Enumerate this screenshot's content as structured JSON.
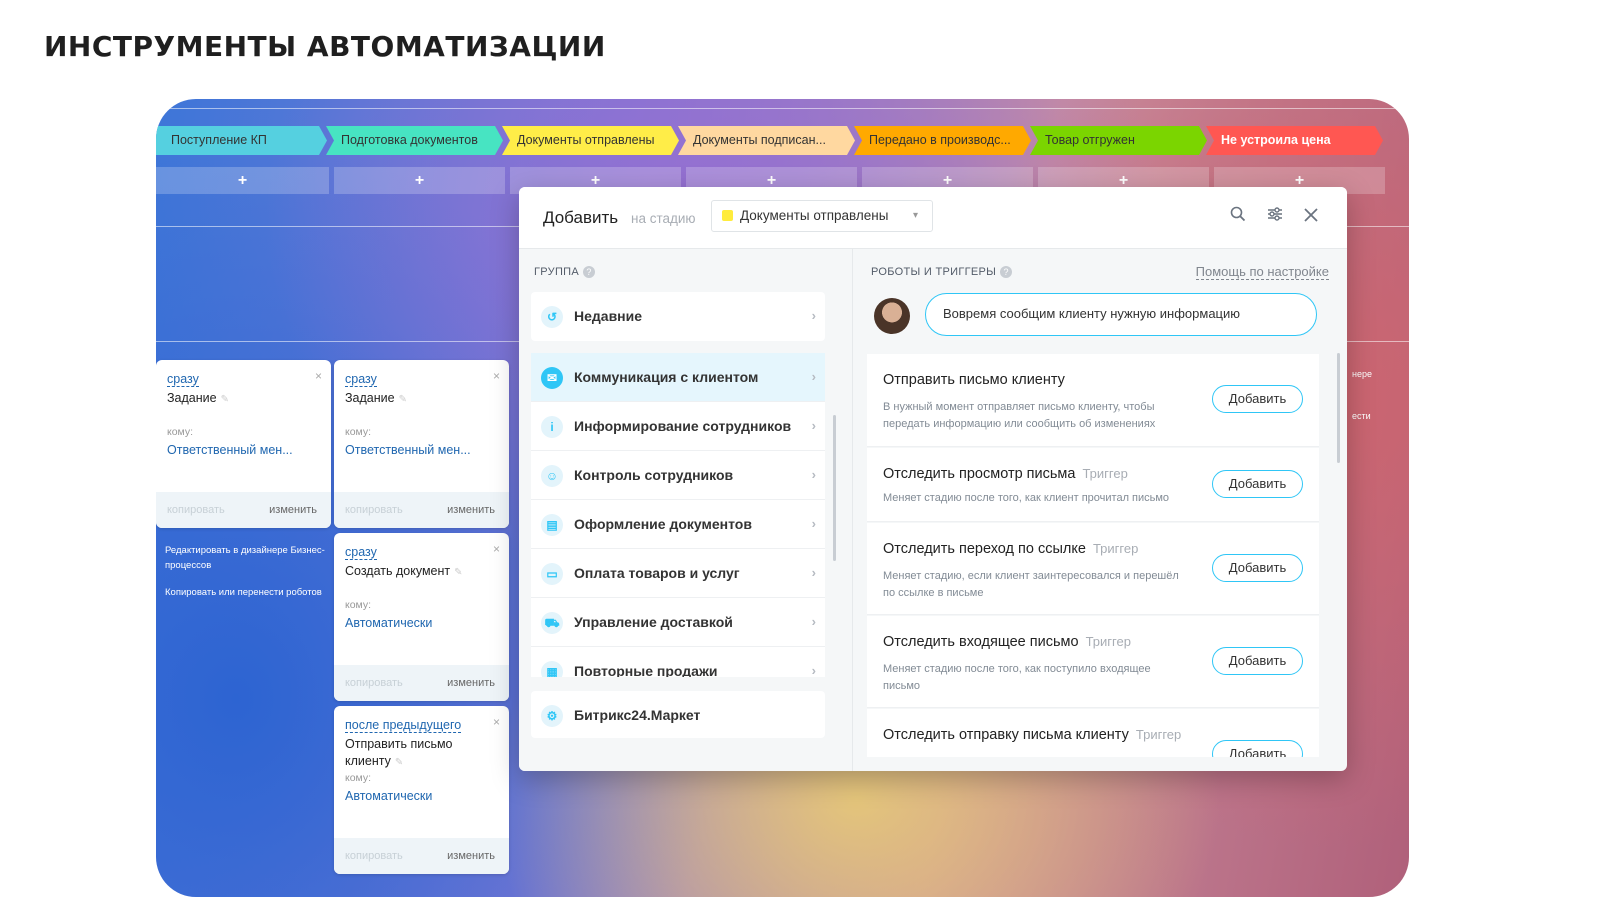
{
  "page": {
    "title": "ИНСТРУМЕНТЫ АВТОМАТИЗАЦИИ"
  },
  "stages": [
    {
      "label": "Поступление КП",
      "color": "#55d0e0"
    },
    {
      "label": "Подготовка документов",
      "color": "#47e4c2"
    },
    {
      "label": "Документы отправлены",
      "color": "#ffed48"
    },
    {
      "label": "Документы подписан...",
      "color": "#ffd8a0"
    },
    {
      "label": "Передано в производс...",
      "color": "#ffa900"
    },
    {
      "label": "Товар отгружен",
      "color": "#7bd500"
    },
    {
      "label": "Не устроила цена",
      "color": "#ff5752"
    }
  ],
  "plus_label": "+",
  "cards": [
    {
      "when": "сразу",
      "name": "Задание",
      "to_label": "кому:",
      "responsible": "Ответственный мен...",
      "copy": "копировать",
      "edit": "изменить"
    },
    {
      "when": "сразу",
      "name": "Задание",
      "to_label": "кому:",
      "responsible": "Ответственный мен...",
      "copy": "копировать",
      "edit": "изменить"
    },
    {
      "when": "сразу",
      "name": "Создать документ",
      "to_label": "кому:",
      "responsible": "Автоматически",
      "copy": "копировать",
      "edit": "изменить"
    },
    {
      "when": "после предыдущего",
      "name": "Отправить письмо клиенту",
      "to_label": "кому:",
      "responsible": "Автоматически",
      "copy": "копировать",
      "edit": "изменить"
    }
  ],
  "close_glyph": "×",
  "side_links": [
    "Редактировать в дизайнере Бизнес-процессов",
    "Копировать или перенести роботов"
  ],
  "edge_texts": [
    "нере",
    "ести"
  ],
  "dialog": {
    "title": "Добавить",
    "subtitle": "на стадию",
    "stage_select": "Документы отправлены",
    "group_header": "ГРУППА",
    "robots_header": "РОБОТЫ И ТРИГГЕРЫ",
    "help_link": "Помощь по настройке",
    "bubble": "Вовремя сообщим клиенту нужную информацию",
    "groups": [
      {
        "label": "Недавние",
        "icon": "history-icon"
      },
      {
        "label": "Коммуникация с клиентом",
        "icon": "chat-icon"
      },
      {
        "label": "Информирование сотрудников",
        "icon": "info-icon"
      },
      {
        "label": "Контроль сотрудников",
        "icon": "people-icon"
      },
      {
        "label": "Оформление документов",
        "icon": "document-icon"
      },
      {
        "label": "Оплата товаров и услуг",
        "icon": "wallet-icon"
      },
      {
        "label": "Управление доставкой",
        "icon": "truck-icon"
      },
      {
        "label": "Повторные продажи",
        "icon": "register-icon"
      },
      {
        "label": "Битрикс24.Маркет",
        "icon": "market-icon"
      }
    ],
    "robots": [
      {
        "title": "Отправить письмо клиенту",
        "tag": "",
        "desc": "В нужный момент отправляет письмо клиенту, чтобы передать информацию или сообщить об изменениях",
        "button": "Добавить"
      },
      {
        "title": "Отследить просмотр письма",
        "tag": "Триггер",
        "desc": "Меняет стадию после того, как клиент прочитал письмо",
        "button": "Добавить"
      },
      {
        "title": "Отследить переход по ссылке",
        "tag": "Триггер",
        "desc": "Меняет стадию, если клиент заинтересовался и перешёл по ссылке в письме",
        "button": "Добавить"
      },
      {
        "title": "Отследить входящее письмо",
        "tag": "Триггер",
        "desc": "Меняет стадию после того, как поступило входящее письмо",
        "button": "Добавить"
      },
      {
        "title": "Отследить отправку письма клиенту",
        "tag": "Триггер",
        "desc": "",
        "button": "Добавить"
      }
    ]
  }
}
